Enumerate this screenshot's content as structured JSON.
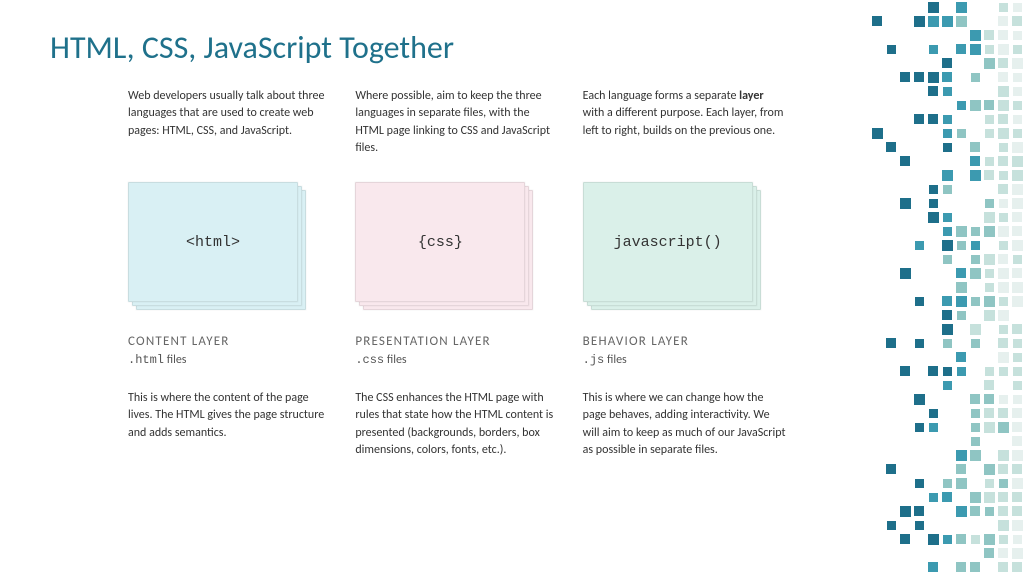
{
  "title": "HTML, CSS, JavaScript Together",
  "intro": {
    "c1": "Web developers usually talk about three languages that are used to create web pages: HTML, CSS, and JavaScript.",
    "c2": "Where possible, aim to keep the three languages in separate files, with the HTML page linking to CSS and JavaScript files.",
    "c3_a": "Each language forms a separate ",
    "c3_b": "layer",
    "c3_c": " with a different purpose. Each layer, from left to right, builds on the previous one."
  },
  "cards": {
    "html": "<html>",
    "css": "{css}",
    "js": "javascript()"
  },
  "layers": {
    "html": {
      "name": "CONTENT  LAYER",
      "ext": ".html",
      "suffix": " files"
    },
    "css": {
      "name": "PRESENTATION LAYER",
      "ext": ".css",
      "suffix": " files"
    },
    "js": {
      "name": "BEHAVIOR LAYER",
      "ext": ".js",
      "suffix": " files"
    }
  },
  "desc": {
    "html": "This is where the content of the page lives. The HTML gives the page structure and adds semantics.",
    "css": "The CSS enhances the HTML page with rules that state how the HTML content is presented (backgrounds, borders, box dimensions, colors, fonts, etc.).",
    "js": "This is where we can change how the page behaves, adding interactivity. We will aim to keep as much of our JavaScript as possible in separate files."
  },
  "deco_palette": [
    "#1e6f8a",
    "#3c9ab0",
    "#8fc5c3",
    "#c6e1dc",
    "#e6f0ee"
  ]
}
